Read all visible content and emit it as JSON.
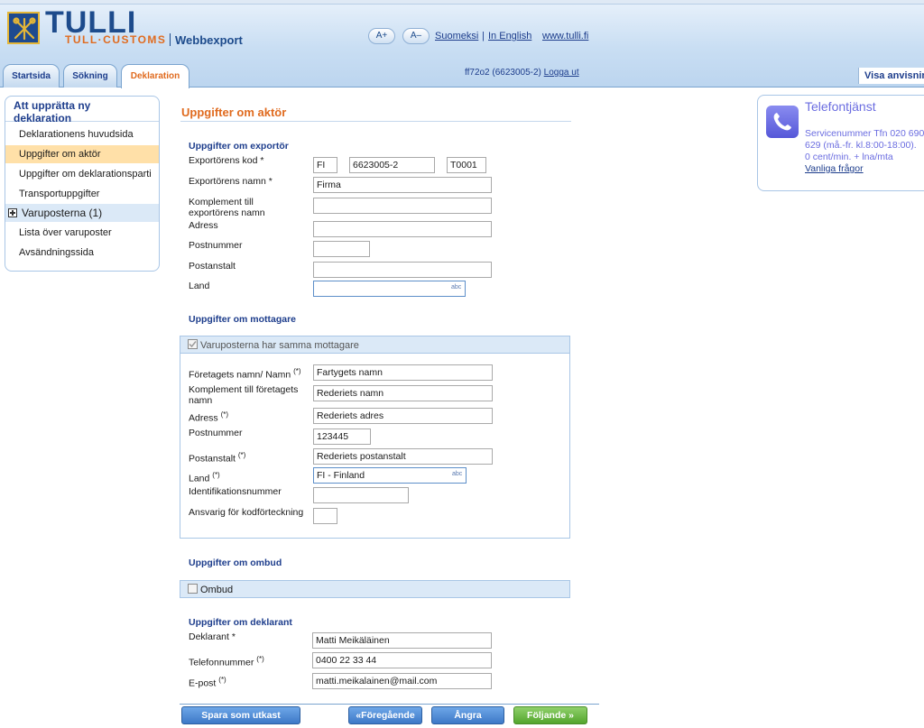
{
  "header": {
    "logo_title": "TULLI",
    "logo_subtitle": "TULL·CUSTOMS",
    "app_name": "Webbexport",
    "font_increase": "A+",
    "font_decrease": "A–",
    "lang_fi": "Suomeksi",
    "lang_en": "In English",
    "site_link": "www.tulli.fi",
    "sep": "|"
  },
  "tabs": [
    {
      "label": "Startsida"
    },
    {
      "label": "Sökning"
    },
    {
      "label": "Deklaration"
    }
  ],
  "session": {
    "user": "ff72o2 (6623005-2)",
    "logout": "Logga ut"
  },
  "visa_button": "Visa anvisning",
  "leftnav": {
    "title": "Att upprätta ny deklaration",
    "items": [
      {
        "label": "Deklarationens huvudsida"
      },
      {
        "label": "Uppgifter om aktör"
      },
      {
        "label": "Uppgifter om deklarationsparti"
      },
      {
        "label": "Transportuppgifter"
      },
      {
        "label": "Varuposterna (1)"
      },
      {
        "label": "Lista över varuposter"
      },
      {
        "label": "Avsändningssida"
      }
    ]
  },
  "form": {
    "title": "Uppgifter om aktör",
    "exporter": {
      "heading": "Uppgifter om exportör",
      "code_label": "Exportörens kod *",
      "code_country": "FI",
      "code_number": "6623005-2",
      "code_suffix": "T0001",
      "name_label": "Exportörens namn *",
      "name_value": "Firma",
      "complement_label": "Komplement till exportörens namn",
      "complement_value": "",
      "address_label": "Adress",
      "address_value": "",
      "postcode_label": "Postnummer",
      "postcode_value": "",
      "city_label": "Postanstalt",
      "city_value": "",
      "country_label": "Land",
      "country_value": "",
      "abc": "abc"
    },
    "consignee": {
      "heading": "Uppgifter om mottagare",
      "same_checkbox": "Varuposterna har samma mottagare",
      "company_label": "Företagets namn/ Namn",
      "company_value": "Fartygets namn",
      "complement_label": "Komplement till företagets namn",
      "complement_value": "Rederiets namn",
      "address_label": "Adress",
      "address_value": "Rederiets adres",
      "postcode_label": "Postnummer",
      "postcode_value": "123445",
      "city_label": "Postanstalt",
      "city_value": "Rederiets postanstalt",
      "country_label": "Land",
      "country_value": "FI - Finland",
      "id_label": "Identifikationsnummer",
      "id_value": "",
      "resp_label": "Ansvarig för kodförteckning",
      "resp_value": "",
      "req_mark": "(*)",
      "abc": "abc"
    },
    "agent": {
      "heading": "Uppgifter om ombud",
      "checkbox": "Ombud"
    },
    "declarant": {
      "heading": "Uppgifter om deklarant",
      "name_label": "Deklarant *",
      "name_value": "Matti Meikäläinen",
      "phone_label": "Telefonnummer",
      "phone_value": "0400 22 33 44",
      "email_label": "E-post",
      "email_value": "matti.meikalainen@mail.com",
      "req_mark": "(*)"
    }
  },
  "buttons": {
    "save_draft": "Spara som utkast",
    "previous": "«Föregående",
    "undo": "Ångra",
    "next": "Följande »"
  },
  "phone": {
    "title": "Telefontjänst",
    "line1": "Servicenummer Tfn 020 690",
    "line2": "629 (må.-fr. kl.8:00-18:00).",
    "line3": "0 cent/min. + lna/mta",
    "faq": "Vanliga frågor"
  },
  "colors": {
    "brand_blue": "#1d4b8c",
    "accent_orange": "#e06b1f",
    "active_nav": "#ffe0a8",
    "next_button": "#53a52d"
  }
}
